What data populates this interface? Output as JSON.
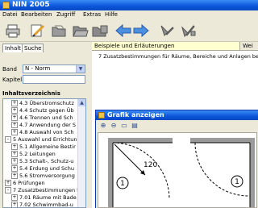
{
  "window": {
    "title": "NIN 2005"
  },
  "menu": [
    "Datei",
    "Bearbeiten",
    "Zugriff",
    "Extras",
    "Hilfe"
  ],
  "toolbar": {
    "buttons": [
      "print-icon",
      "edit-icon",
      "folder-icon",
      "folder-open-icon",
      "back-arrow-icon",
      "forward-arrow-icon",
      "bookmark-add-icon",
      "bookmark-remove-icon"
    ]
  },
  "left": {
    "tabs": [
      "Inhalt",
      "Suche"
    ],
    "band_label": "Band",
    "band_value": "N - Norm",
    "kapitel_label": "Kapitel",
    "kapitel_value": "",
    "toc_title": "Inhaltsverzeichnis",
    "tree": [
      {
        "pm": "+",
        "text": "4.3 Überstromschutz"
      },
      {
        "pm": "+",
        "text": "4.4 Schutz gegen Üb"
      },
      {
        "pm": "+",
        "text": "4.6 Trennen und Sch"
      },
      {
        "pm": "+",
        "text": "4.7 Anwendung der S"
      },
      {
        "pm": "+",
        "text": "4.8 Auswahl von Sch"
      },
      {
        "pm": "-",
        "text": "5 Auswahl und Errichtun"
      },
      {
        "pm": "+",
        "text": "5.1 Allgemeine Bestir"
      },
      {
        "pm": "+",
        "text": "5.2 Leitungen"
      },
      {
        "pm": "+",
        "text": "5.3 Schalt-, Schutz-u"
      },
      {
        "pm": "+",
        "text": "5.4 Erdung und Schu"
      },
      {
        "pm": "+",
        "text": "5.6 Stromversorgung"
      },
      {
        "pm": "+",
        "text": "6 Prüfungen"
      },
      {
        "pm": "-",
        "text": "7 Zusatzbestimmungen f"
      },
      {
        "pm": "+",
        "text": "7.01 Räume mit Bade"
      },
      {
        "pm": "+",
        "text": "7.02 Schwimmbad-u"
      }
    ]
  },
  "right": {
    "col1": "Beispiele und Erläuterungen",
    "col2": "Wei",
    "row": "7 Zusatzbestimmungen für Räume, Bereiche und Anlagen beson"
  },
  "dialog": {
    "title": "Grafik anzeigen",
    "dimension": "120",
    "marker_left": "1",
    "marker_right": "1"
  }
}
